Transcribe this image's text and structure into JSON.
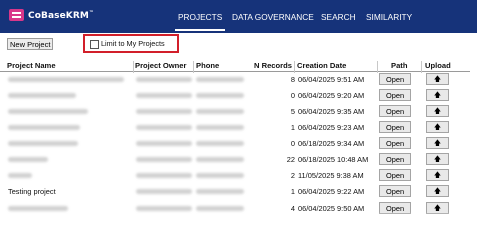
{
  "app": {
    "logo_text": "CoBaseKRM",
    "logo_mark": "™"
  },
  "nav": {
    "items": [
      {
        "label": "PROJECTS",
        "active": true
      },
      {
        "label": "DATA GOVERNANCE",
        "active": false
      },
      {
        "label": "SEARCH",
        "active": false
      },
      {
        "label": "SIMILARITY",
        "active": false
      }
    ]
  },
  "toolbar": {
    "new_project_label": "New Project",
    "limit_label": "Limit to My Projects",
    "limit_checked": false
  },
  "table": {
    "columns": [
      "Project Name",
      "Project Owner",
      "Phone",
      "N Records",
      "Creation Date",
      "Path",
      "Upload"
    ],
    "open_label": "Open",
    "upload_icon": "up-arrow-icon",
    "rows": [
      {
        "name": "",
        "n_records": "8",
        "date": "06/04/2025 9:51 AM"
      },
      {
        "name": "",
        "n_records": "0",
        "date": "06/04/2025 9:20 AM"
      },
      {
        "name": "",
        "n_records": "5",
        "date": "06/04/2025 9:35 AM"
      },
      {
        "name": "",
        "n_records": "1",
        "date": "06/04/2025 9:23 AM"
      },
      {
        "name": "",
        "n_records": "0",
        "date": "06/18/2025 9:34 AM"
      },
      {
        "name": "",
        "n_records": "22",
        "date": "06/18/2025 10:48 AM"
      },
      {
        "name": "",
        "n_records": "2",
        "date": "11/05/2025 9:38 AM"
      },
      {
        "name": "Testing project",
        "n_records": "1",
        "date": "06/04/2025 9:22 AM"
      },
      {
        "name": "",
        "n_records": "4",
        "date": "06/04/2025 9:50 AM"
      }
    ]
  },
  "colors": {
    "topbar": "#16337a",
    "logo_accent": "#d9378a",
    "highlight_border": "#d21f2a"
  }
}
